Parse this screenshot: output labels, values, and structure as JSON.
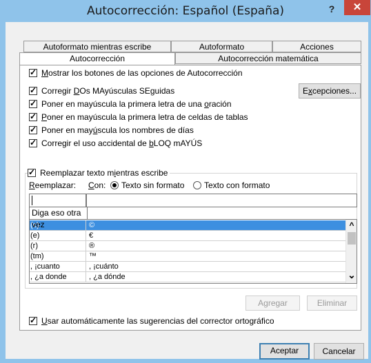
{
  "window": {
    "title": "Autocorrección: Español (España)",
    "help_label": "?",
    "close_label": "✕"
  },
  "tabs": {
    "row1": [
      "Autoformato mientras escribe",
      "Autoformato",
      "Acciones"
    ],
    "row2": [
      "Autocorrección",
      "Autocorrección matemática"
    ]
  },
  "options": {
    "show_buttons": {
      "pre": "",
      "u": "M",
      "post": "ostrar los botones de las opciones de Autocorrección",
      "checked": true
    },
    "two_caps": {
      "pre": "Corregir ",
      "u": "D",
      "post": "Os MAyúsculas SEguidas",
      "checked": true
    },
    "sentence": {
      "pre": "Poner en mayúscula la primera letra de una ",
      "u": "o",
      "post": "ración",
      "checked": true
    },
    "table_cells": {
      "pre": "",
      "u": "P",
      "post": "oner en mayúscula la primera letra de celdas de tablas",
      "checked": true
    },
    "day_names": {
      "pre": "Poner en may",
      "u": "ú",
      "post": "scula los nombres de días",
      "checked": true
    },
    "caps_lock": {
      "pre": "Corregir el uso accidental de ",
      "u": "b",
      "post": "LOQ mAYÚS",
      "checked": true
    }
  },
  "exceptions_button": {
    "pre": "E",
    "u": "x",
    "post": "cepciones..."
  },
  "replace_group": {
    "checkbox": {
      "pre": "Reemplazar texto m",
      "u": "i",
      "post": "entras escribe",
      "checked": true
    },
    "replace_label": {
      "u": "R",
      "post": "eemplazar:"
    },
    "with_label": {
      "u": "C",
      "post": "on:"
    },
    "radio_plain": "Texto sin formato",
    "radio_formatted": "Texto con formato",
    "plain_selected": true,
    "replace_value": "",
    "with_value": "",
    "tooltip": "Diga eso otra vez"
  },
  "list": {
    "rows": [
      {
        "from": "(c)",
        "to": "©",
        "selected": true
      },
      {
        "from": "(e)",
        "to": "€",
        "selected": false
      },
      {
        "from": "(r)",
        "to": "®",
        "selected": false
      },
      {
        "from": "(tm)",
        "to": "™",
        "selected": false
      },
      {
        "from": ", ¡cuanto",
        "to": ", ¡cuánto",
        "selected": false
      },
      {
        "from": ", ¿a donde",
        "to": ", ¿a dónde",
        "selected": false
      }
    ],
    "scroll_up": "^",
    "scroll_down": "⌄"
  },
  "buttons": {
    "add": "Agregar",
    "delete": "Eliminar",
    "ok": "Aceptar",
    "cancel": "Cancelar"
  },
  "spell": {
    "pre": "",
    "u": "U",
    "post": "sar automáticamente las sugerencias del corrector ortográfico",
    "checked": true
  },
  "colors": {
    "titlebar": "#8fc3ea",
    "close": "#c8453a",
    "selection": "#3d8fe0"
  }
}
